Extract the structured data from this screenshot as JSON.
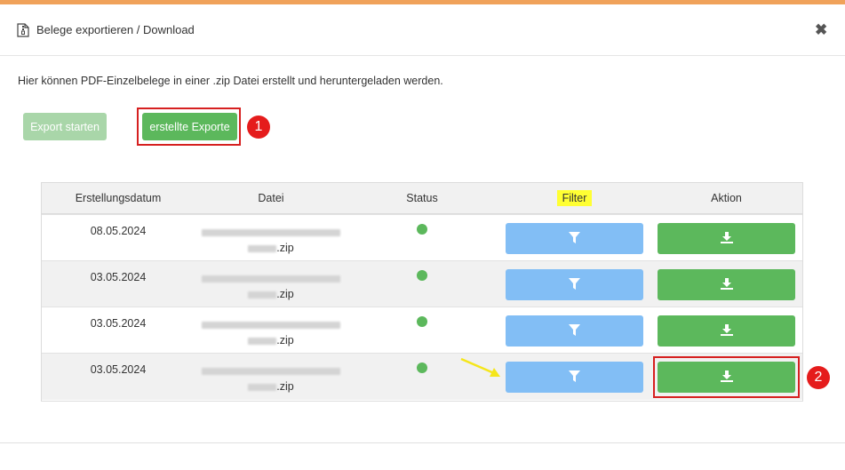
{
  "dialog": {
    "title": "Belege exportieren / Download",
    "close_glyph": "✖",
    "intro": "Hier können PDF-Einzelbelege in einer .zip Datei erstellt und heruntergeladen werden."
  },
  "buttons": {
    "export_start": "Export starten",
    "created_exports": "erstellte Exporte"
  },
  "markers": [
    "1",
    "2"
  ],
  "table": {
    "headers": {
      "date": "Erstellungsdatum",
      "file": "Datei",
      "status": "Status",
      "filter": "Filter",
      "action": "Aktion"
    },
    "rows": [
      {
        "date": "08.05.2024",
        "file_suffix": ".zip",
        "status": "ok"
      },
      {
        "date": "03.05.2024",
        "file_suffix": ".zip",
        "status": "ok"
      },
      {
        "date": "03.05.2024",
        "file_suffix": ".zip",
        "status": "ok"
      },
      {
        "date": "03.05.2024",
        "file_suffix": ".zip",
        "status": "ok"
      }
    ]
  },
  "colors": {
    "accent_top": "#f0a25a",
    "green": "#5cb85c",
    "light_green": "#a9d6a9",
    "blue": "#82bef5",
    "highlight_red": "#d62020",
    "highlight_yellow": "#ffff33"
  },
  "icons": {
    "document": "document-zip-icon",
    "filter": "filter-icon",
    "download": "download-icon",
    "close": "close-icon",
    "arrow": "yellow-arrow-icon"
  }
}
